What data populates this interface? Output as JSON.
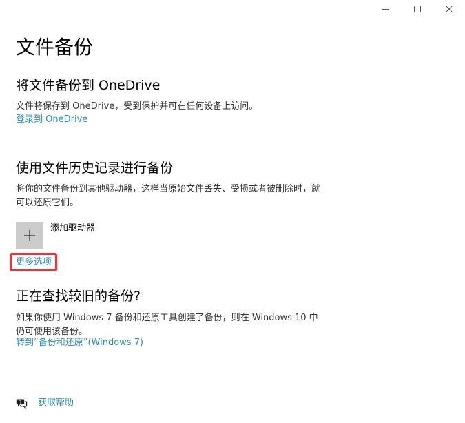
{
  "window": {
    "controls": {
      "minimize": "minimize-icon",
      "maximize": "maximize-icon",
      "close": "close-icon"
    }
  },
  "page": {
    "title": "文件备份"
  },
  "onedrive": {
    "title": "将文件备份到 OneDrive",
    "description": "文件将保存到 OneDrive，受到保护并可在任何设备上访问。",
    "signin_link": "登录到 OneDrive"
  },
  "file_history": {
    "title": "使用文件历史记录进行备份",
    "description": "将你的文件备份到其他驱动器，这样当原始文件丢失、受损或者被删除时，就可以还原它们。",
    "add_drive_label": "添加驱动器",
    "add_drive_icon": "plus-icon",
    "more_options_link": "更多选项"
  },
  "older_backup": {
    "title": "正在查找较旧的备份?",
    "description": "如果你使用 Windows 7 备份和还原工具创建了备份，则在 Windows 10 中仍可使用该备份。",
    "goto_link": "转到“备份和还原”(Windows 7)"
  },
  "help": {
    "label": "获取帮助",
    "icon": "help-chat-icon"
  },
  "colors": {
    "link": "#2a8fb3",
    "add_tile": "#cccccc",
    "highlight": "#e8343a"
  }
}
